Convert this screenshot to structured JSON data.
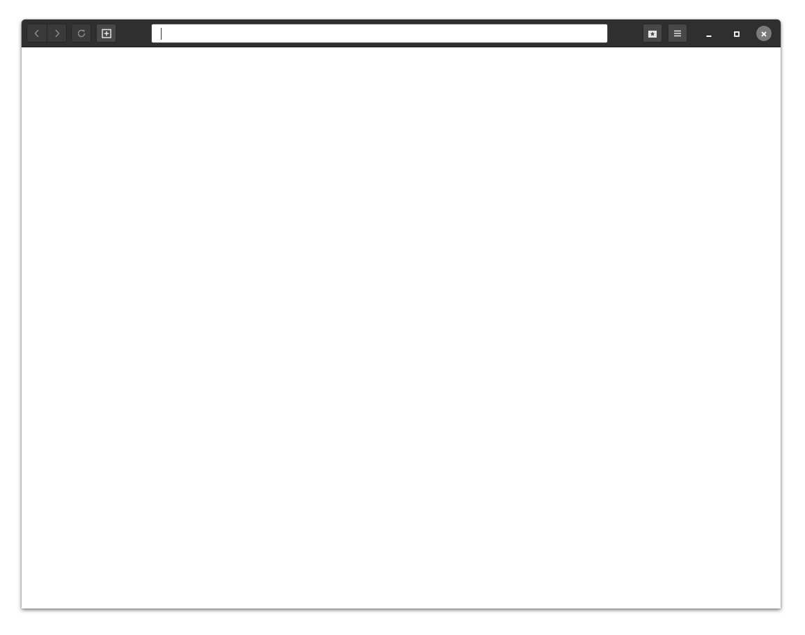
{
  "browser": {
    "toolbar": {
      "back_icon": "chevron-left-icon",
      "forward_icon": "chevron-right-icon",
      "reload_icon": "reload-icon",
      "new_tab_icon": "new-tab-icon",
      "bookmarks_icon": "bookmark-star-icon",
      "menu_icon": "hamburger-menu-icon"
    },
    "url_bar": {
      "value": "",
      "placeholder": ""
    },
    "window_controls": {
      "minimize_icon": "minimize-icon",
      "maximize_icon": "maximize-icon",
      "close_icon": "close-icon"
    },
    "colors": {
      "headerbar": "#2f2f2f",
      "button": "#3a3a3a",
      "icon": "#9a9a9a",
      "close_button": "#7a7a7a",
      "content": "#ffffff"
    }
  }
}
